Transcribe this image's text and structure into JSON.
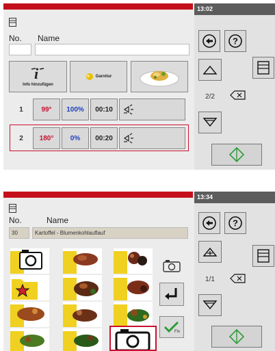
{
  "screen1": {
    "time": "13:02",
    "header": {
      "no_label": "No.",
      "name_label": "Name",
      "no_value": "",
      "name_value": ""
    },
    "buttons": {
      "info_label": "Info hinzufügen",
      "garnish_label": "Garnitur"
    },
    "steps": [
      {
        "index": "1",
        "temp": "99°",
        "humidity": "100%",
        "time": "00:10"
      },
      {
        "index": "2",
        "temp": "180°",
        "humidity": "0%",
        "time": "00:20"
      }
    ],
    "page": "2/2"
  },
  "screen2": {
    "time": "13:34",
    "header": {
      "no_label": "No.",
      "name_label": "Name",
      "no_value": "30",
      "name_value": "Kartoffel - Blumenkohlauflauf"
    },
    "page": "1/1"
  },
  "colors": {
    "accent_red": "#c4101a",
    "temp_red": "#c8102e",
    "humidity_blue": "#1f3fbf",
    "start_green": "#2e9c3a"
  }
}
